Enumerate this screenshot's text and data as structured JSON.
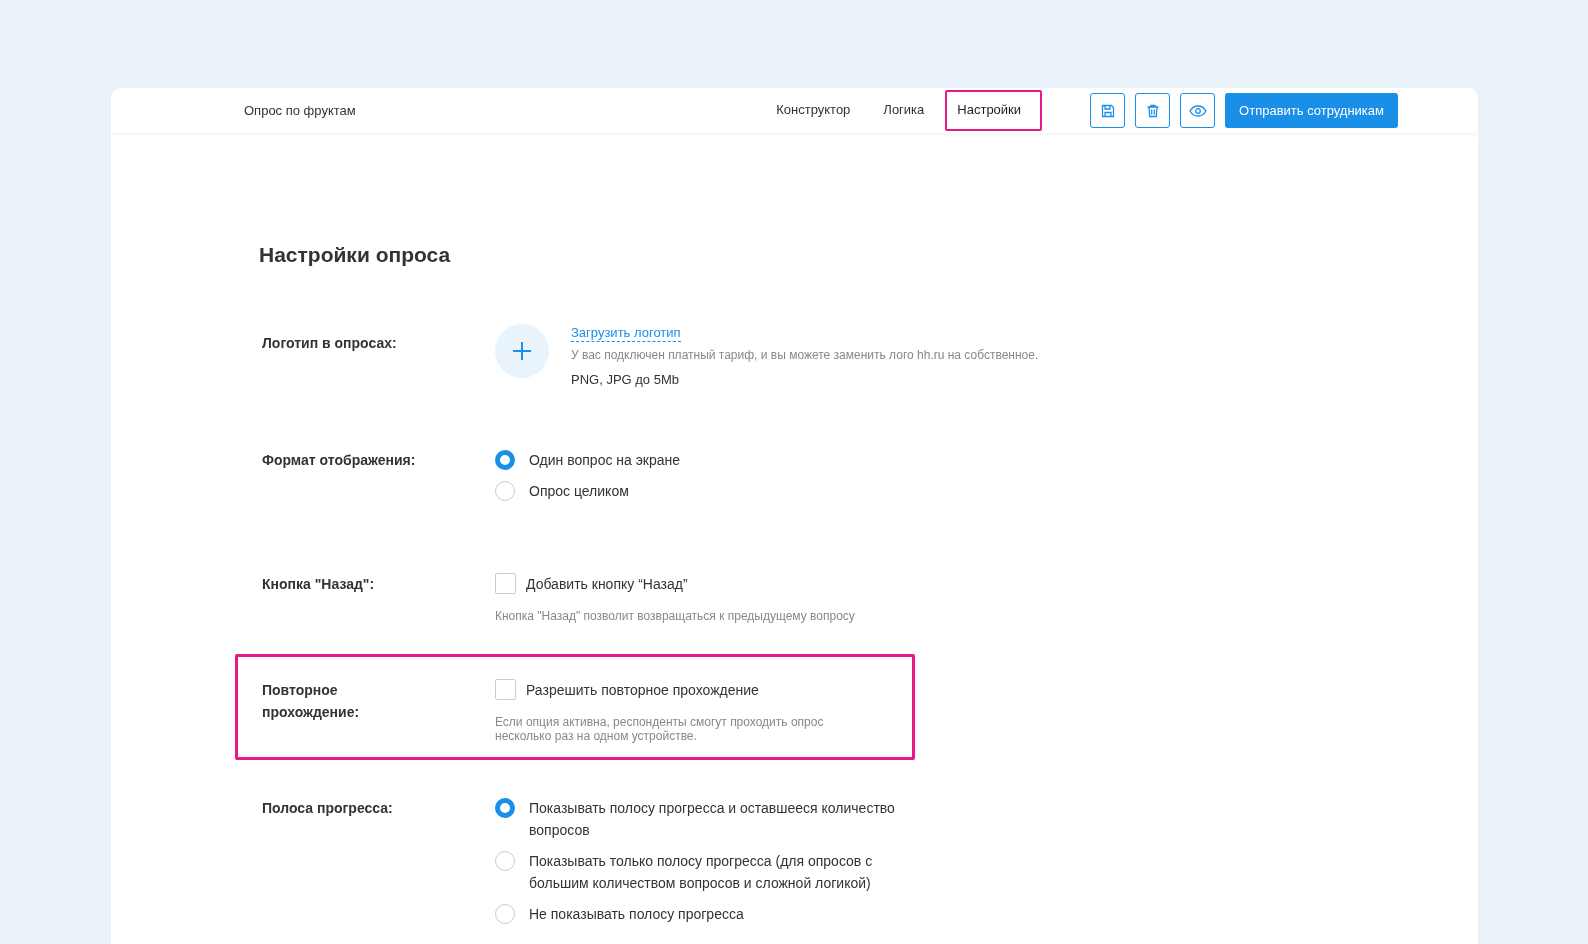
{
  "header": {
    "title": "Опрос по фруктам",
    "tabs": [
      {
        "label": "Конструктор",
        "selected": false,
        "highlighted": false
      },
      {
        "label": "Логика",
        "selected": false,
        "highlighted": false
      },
      {
        "label": "Настройки",
        "selected": true,
        "highlighted": true
      }
    ],
    "send_button": "Отправить сотрудникам"
  },
  "heading": "Настройки опроса",
  "sections": [
    {
      "kind": "logo",
      "label": "Логотип в опросах:",
      "highlighted": false,
      "link": "Загрузить логотип",
      "note": "У вас подключен платный тариф, и вы можете заменить лого hh.ru на собственное.",
      "formats": "PNG, JPG до 5Mb"
    },
    {
      "kind": "radio",
      "label": "Формат отображения:",
      "highlighted": false,
      "options": [
        {
          "label": "Один вопрос на экране",
          "selected": true
        },
        {
          "label": "Опрос целиком",
          "selected": false
        }
      ]
    },
    {
      "kind": "checkbox",
      "label": "Кнопка \"Назад\":",
      "highlighted": false,
      "option": {
        "label": "Добавить кнопку “Назад”",
        "checked": false
      },
      "hint": "Кнопка \"Назад\" позволит возвращаться к предыдущему вопросу"
    },
    {
      "kind": "checkbox",
      "label": "Повторное прохождение:",
      "highlighted": true,
      "option": {
        "label": "Разрешить повторное прохождение",
        "checked": false
      },
      "hint": "Если опция активна, респонденты смогут проходить опрос несколько раз на одном устройстве."
    },
    {
      "kind": "radio",
      "label": "Полоса прогресса:",
      "highlighted": false,
      "options": [
        {
          "label": "Показывать полосу прогресса и оставшееся количество вопросов",
          "selected": true
        },
        {
          "label": "Показывать только полосу прогресса (для опросов с большим количеством вопросов и сложной логикой)",
          "selected": false
        },
        {
          "label": "Не показывать полосу прогресса",
          "selected": false
        }
      ]
    }
  ]
}
